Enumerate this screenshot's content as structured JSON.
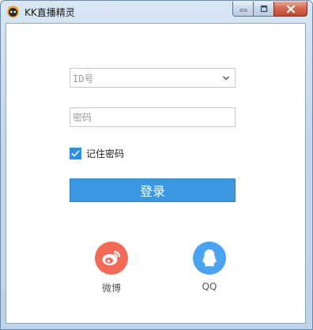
{
  "window": {
    "title": "KK直播精灵",
    "controls": {
      "minimize": "minimize",
      "maximize": "maximize",
      "close": "close"
    }
  },
  "form": {
    "id_select": {
      "placeholder": "ID号",
      "value": ""
    },
    "password": {
      "placeholder": "密码",
      "value": ""
    },
    "remember": {
      "label": "记住密码",
      "checked": true
    },
    "login_label": "登录"
  },
  "social": [
    {
      "name": "weibo",
      "label": "微博",
      "icon": "weibo-icon",
      "color": "#f06a55"
    },
    {
      "name": "qq",
      "label": "QQ",
      "icon": "qq-icon",
      "color": "#4aa3f0"
    }
  ],
  "colors": {
    "accent": "#3a98e0",
    "checkbox": "#2e8fe0"
  }
}
